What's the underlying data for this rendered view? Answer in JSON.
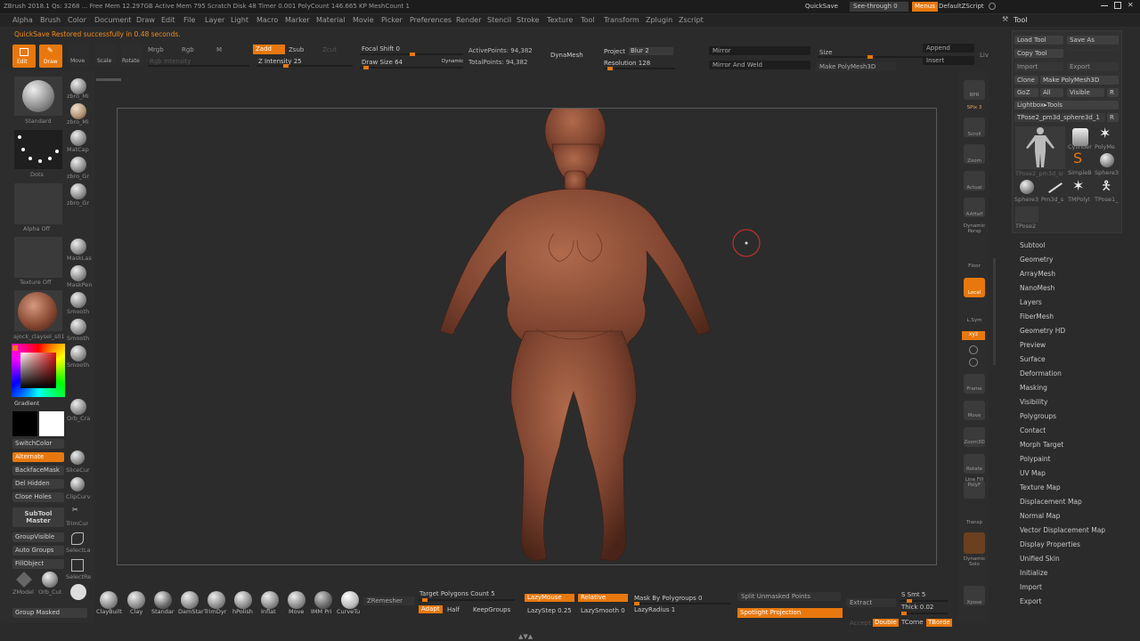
{
  "titlebar": {
    "text": "ZBrush 2018.1    Qs: 3268   ...  Free Mem 12.297GB  Active Mem 795  Scratch Disk 48  Timer 0.001  PolyCount 146.665 KP  MeshCount 1",
    "quicksave": "QuickSave",
    "seethrough": "See-through  0",
    "menus_btn": "Menus",
    "script": "DefaultZScript"
  },
  "menu": [
    "Alpha",
    "Brush",
    "Color",
    "Document",
    "Draw",
    "Edit",
    "File",
    "Layer",
    "Light",
    "Macro",
    "Marker",
    "Material",
    "Movie",
    "Picker",
    "Preferences",
    "Render",
    "Stencil",
    "Stroke",
    "Texture",
    "Tool",
    "Transform",
    "Zplugin",
    "Zscript"
  ],
  "notice": "QuickSave Restored successfully in 0.48 seconds.",
  "toolbar": {
    "edit": "Edit",
    "draw": "Draw",
    "move": "Move",
    "scale": "Scale",
    "rotate": "Rotate",
    "mrgb": "Mrgb",
    "rgb": "Rgb",
    "m": "M",
    "zadd": "Zadd",
    "zsub": "Zsub",
    "zcut": "Zcut",
    "rgb_intensity": "Rgb Intensity",
    "z_intensity": "Z Intensity 25",
    "focal_shift": "Focal Shift 0",
    "draw_size": "Draw Size 64",
    "dynamic": "Dynamic",
    "active_points": "ActivePoints: 94,382",
    "total_points": "TotalPoints: 94,382",
    "dynamesh": "DynaMesh",
    "project": "Project",
    "blur": "Blur 2",
    "resolution": "Resolution 128",
    "mirror": "Mirror",
    "mirror_weld": "Mirror And Weld",
    "make_polymesh": "Make PolyMesh3D",
    "size": "Size",
    "append": "Append",
    "insert": "Insert",
    "liv": "Liv"
  },
  "left": {
    "standard": "Standard",
    "dots": "Dots",
    "alpha_off": "Alpha Off",
    "texture_off": "Texture Off",
    "material": "ajock_claysel_s01",
    "gradient": "Gradient",
    "switchcolor": "SwitchColor",
    "alternate": "Alternate",
    "backface": "BackfaceMask",
    "del_hidden": "Del Hidden",
    "close_holes": "Close Holes",
    "subtool_master": "SubTool Master",
    "groupvisible": "GroupVisible",
    "auto_groups": "Auto Groups",
    "fillobject": "FillObject",
    "zmodeler": "ZModel",
    "group_masked": "Group Masked",
    "brushes": [
      "zbro_Mi",
      "zbro_Mi",
      "MatCap",
      "zbro_Gr",
      "zbro_Gr",
      "MaskLas",
      "MaskPen",
      "Smooth",
      "Smooth",
      "Smooth",
      "Orb_Cra",
      "SliceCur",
      "ClipCurv",
      "TrimCur",
      "SelectLa",
      "SelectRe",
      "Orb_Cut"
    ]
  },
  "right_strip": [
    "BPR",
    "SPix 3",
    "Scroll",
    "Zoom",
    "Actual",
    "AAHalf",
    "Dynamic Persp",
    "Floor",
    "Local",
    "L.Sym",
    "xyz",
    "Frame",
    "Move",
    "Zoom3D",
    "Rotate",
    "Line Fill PolyF",
    "Transp",
    "Dynamic Solo",
    "Xpose"
  ],
  "tool": {
    "title": "Tool",
    "load": "Load Tool",
    "saveas": "Save As",
    "copy": "Copy Tool",
    "import": "Import",
    "export": "Export",
    "clone": "Clone",
    "makepoly": "Make PolyMesh3D",
    "goz": "GoZ",
    "all": "All",
    "visible": "Visible",
    "r": "R",
    "lightbox": "Lightbox▸Tools",
    "current": "TPose2_pm3d_sphere3d_1",
    "r2": "R",
    "thumbs": [
      "TPose2_pm3d_sr",
      "Cylinder",
      "PolyMe",
      "SimpleB",
      "Sphere3",
      "Sphere3",
      "Pm3d_s",
      "TMPolyl",
      "TPose1_",
      "TPose2"
    ]
  },
  "subpalettes": [
    "Subtool",
    "Geometry",
    "ArrayMesh",
    "NanoMesh",
    "Layers",
    "FiberMesh",
    "Geometry HD",
    "Preview",
    "Surface",
    "Deformation",
    "Masking",
    "Visibility",
    "Polygroups",
    "Contact",
    "Morph Target",
    "Polypaint",
    "UV Map",
    "Texture Map",
    "Displacement Map",
    "Normal Map",
    "Vector Displacement Map",
    "Display Properties",
    "Unified Skin",
    "Initialize",
    "Import",
    "Export"
  ],
  "bottom": {
    "brushes": [
      "ClayBuilt",
      "Clay",
      "Standar",
      "DamStar",
      "TrimDyr",
      "hPolish",
      "Inflat",
      "Move",
      "IMM Pri",
      "CurveTu"
    ],
    "zremesher": "ZRemesher",
    "target": "Target Polygons Count 5",
    "adapt": "Adapt",
    "half": "Half",
    "keepgroups": "KeepGroups",
    "lazymouse": "LazyMouse",
    "relative": "Relative",
    "lazystep": "LazyStep 0.25",
    "lazysmooth": "LazySmooth 0",
    "lazyradius": "LazyRadius 1",
    "maskbypoly": "Mask By Polygroups 0",
    "split": "Split Unmasked Points",
    "spotlight": "Spotlight Projection",
    "extract": "Extract",
    "ssmt": "S Smt 5",
    "thick": "Thick 0.02",
    "accept": "Accept",
    "double": "Double",
    "tcorne": "TCorne",
    "tborde": "TBorde"
  },
  "colors": {
    "accent": "#e8780e",
    "bg": "#2b2b2b",
    "skin": "#8a4a33"
  }
}
